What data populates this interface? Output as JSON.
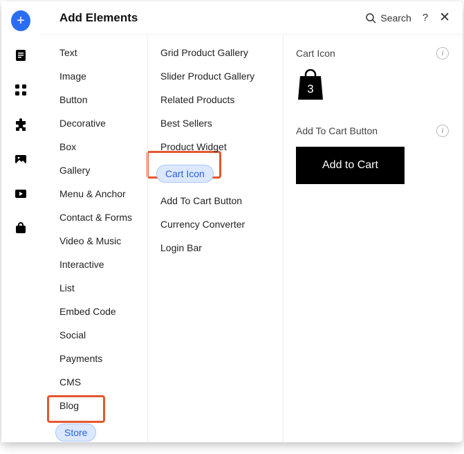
{
  "header": {
    "title": "Add Elements",
    "search_label": "Search"
  },
  "categories": [
    "Text",
    "Image",
    "Button",
    "Decorative",
    "Box",
    "Gallery",
    "Menu & Anchor",
    "Contact & Forms",
    "Video & Music",
    "Interactive",
    "List",
    "Embed Code",
    "Social",
    "Payments",
    "CMS",
    "Blog",
    "Store"
  ],
  "selected_category": "Store",
  "elements": [
    "Grid Product Gallery",
    "Slider Product Gallery",
    "Related Products",
    "Best Sellers",
    "Product Widget",
    "Cart Icon",
    "Add To Cart Button",
    "Currency Converter",
    "Login Bar"
  ],
  "selected_element": "Cart Icon",
  "preview": {
    "section1_title": "Cart Icon",
    "cart_count": "3",
    "section2_title": "Add To Cart Button",
    "atc_label": "Add to Cart"
  }
}
